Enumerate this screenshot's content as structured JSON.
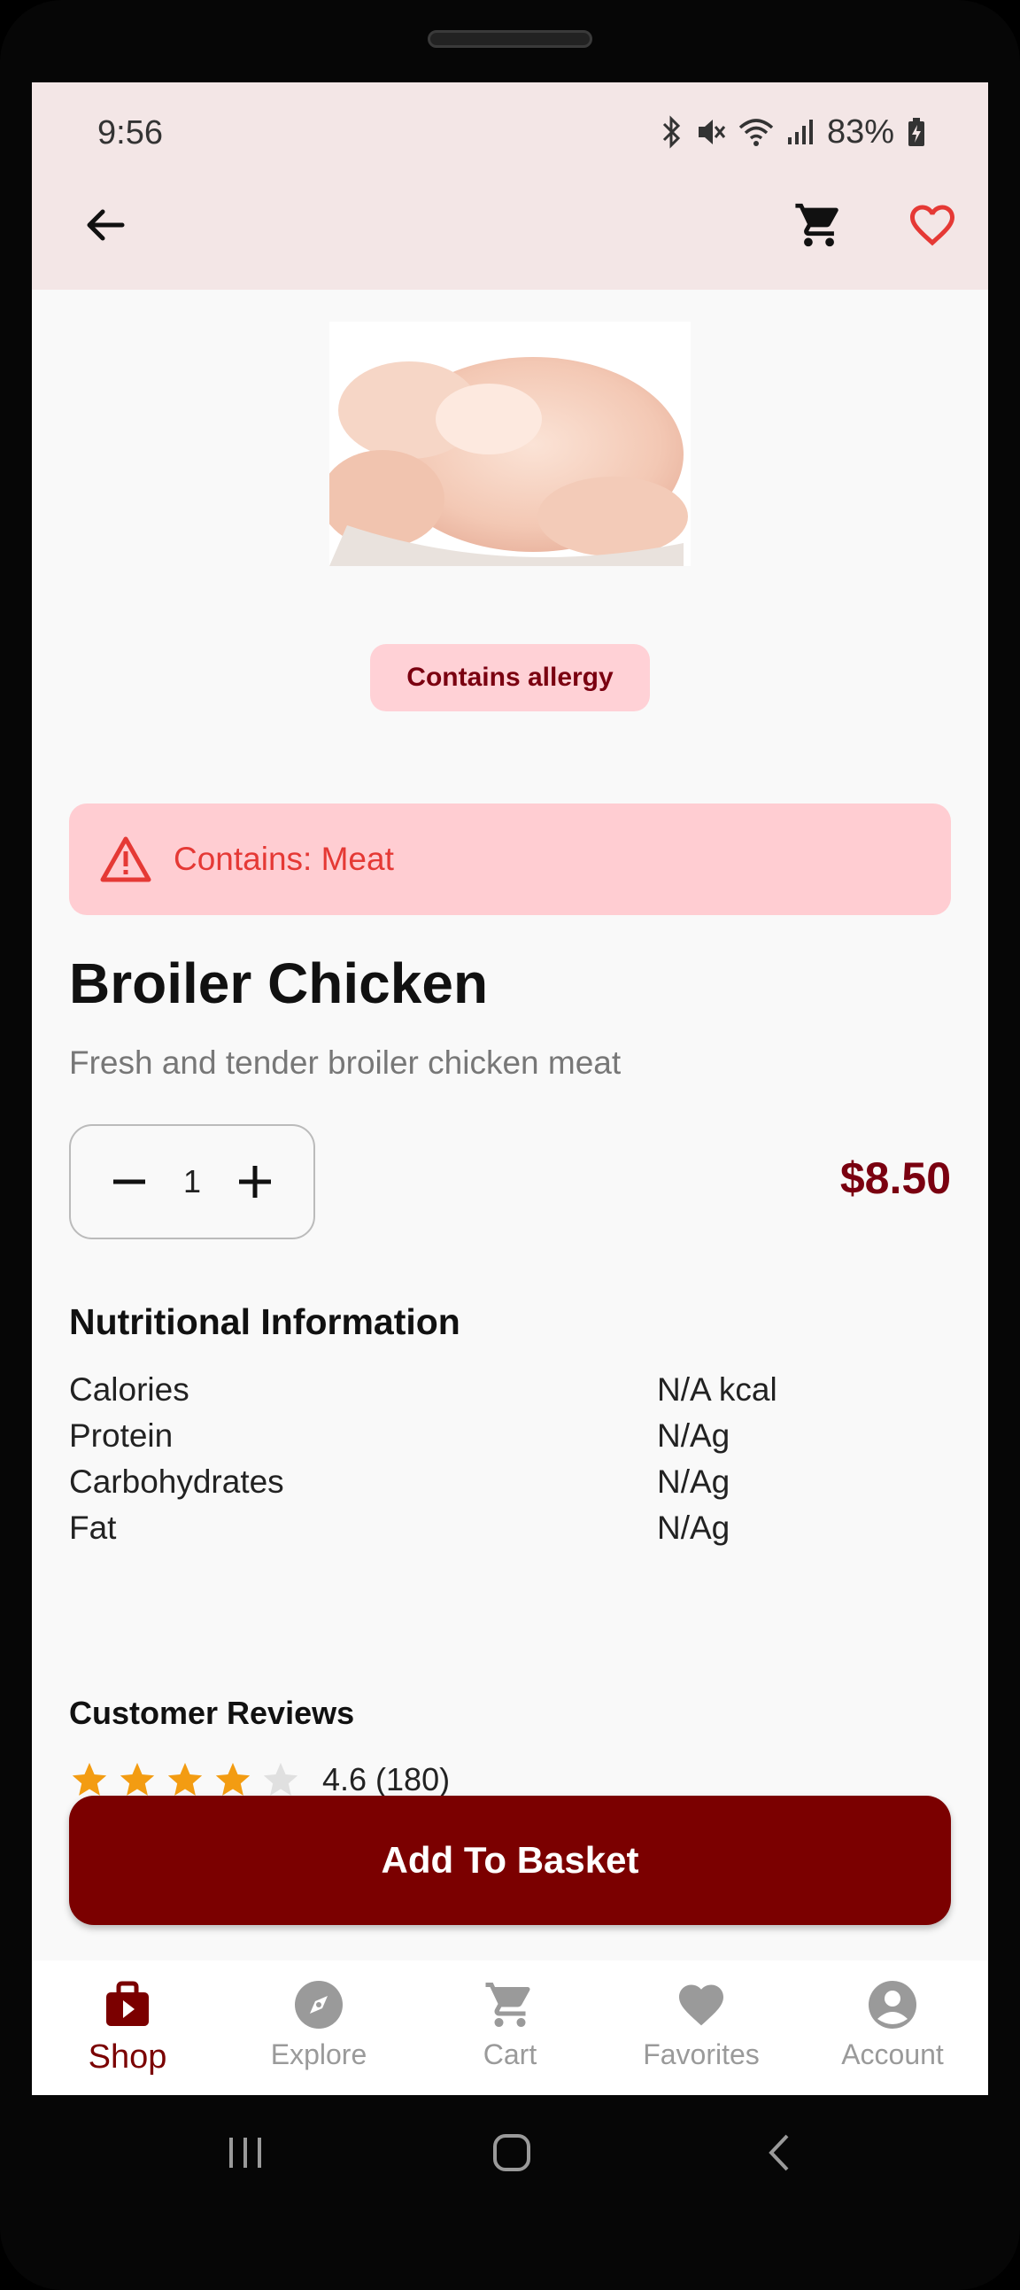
{
  "status_bar": {
    "time": "9:56",
    "battery": "83%"
  },
  "app_bar": {
    "back_icon": "arrow-back-icon",
    "cart_icon": "shopping-cart-icon",
    "favorite_icon": "heart-outline-icon"
  },
  "product": {
    "allergy_chip": "Contains allergy",
    "warning": "Contains: Meat",
    "title": "Broiler Chicken",
    "description": "Fresh and tender broiler chicken meat",
    "quantity": "1",
    "price": "$8.50"
  },
  "nutrition": {
    "title": "Nutritional Information",
    "rows": [
      {
        "label": "Calories",
        "value": "N/A kcal"
      },
      {
        "label": "Protein",
        "value": "N/Ag"
      },
      {
        "label": "Carbohydrates",
        "value": "N/Ag"
      },
      {
        "label": "Fat",
        "value": "N/Ag"
      }
    ]
  },
  "reviews": {
    "title": "Customer Reviews",
    "stars_filled": 4,
    "stars_total": 5,
    "rating_text": "4.6 (180)"
  },
  "actions": {
    "add_to_basket": "Add To Basket"
  },
  "bottom_nav": {
    "items": [
      {
        "label": "Shop",
        "icon": "shopping-bag-icon",
        "active": true
      },
      {
        "label": "Explore",
        "icon": "compass-icon",
        "active": false
      },
      {
        "label": "Cart",
        "icon": "cart-icon",
        "active": false
      },
      {
        "label": "Favorites",
        "icon": "heart-icon",
        "active": false
      },
      {
        "label": "Account",
        "icon": "account-circle-icon",
        "active": false
      }
    ]
  },
  "colors": {
    "accent": "#7b0000",
    "warning_bg": "#ffcdd2",
    "warning_text": "#e53935",
    "app_bar_bg": "#f3e6e6",
    "star": "#f39c12"
  }
}
